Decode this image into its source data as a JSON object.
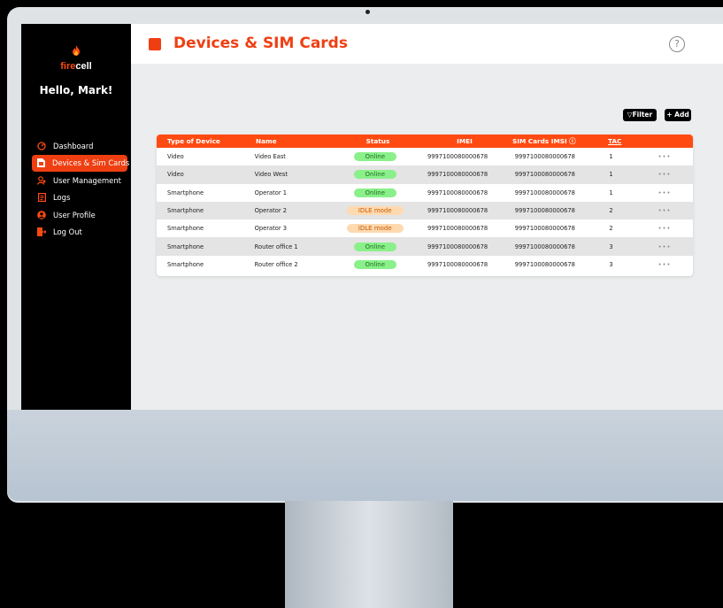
{
  "brand": {
    "fire": "fire",
    "cell": "cell"
  },
  "greeting": "Hello, Mark!",
  "nav": [
    {
      "label": "Dashboard",
      "icon": "dashboard-icon"
    },
    {
      "label": "Devices & Sim Cards",
      "icon": "sim-card-icon",
      "active": true
    },
    {
      "label": "User Management",
      "icon": "user-management-icon"
    },
    {
      "label": "Logs",
      "icon": "logs-icon"
    },
    {
      "label": "User Profile",
      "icon": "user-profile-icon"
    },
    {
      "label": "Log Out",
      "icon": "logout-icon"
    }
  ],
  "page": {
    "title": "Devices & SIM Cards",
    "help": "?"
  },
  "toolbar": {
    "filter": "Filter",
    "add": "+ Add"
  },
  "table": {
    "headers": [
      "Type of Device",
      "Name",
      "Status",
      "IMEI",
      "SIM Cards IMSI",
      "TAC"
    ],
    "rows": [
      {
        "type": "Video",
        "name": "Video East",
        "status": "Online",
        "imei": "9997100080000678",
        "imsi": "9997100080000678",
        "tac": "1",
        "more": "•••"
      },
      {
        "type": "Video",
        "name": "Video West",
        "status": "Online",
        "imei": "9997100080000678",
        "imsi": "9997100080000678",
        "tac": "1",
        "more": "•••"
      },
      {
        "type": "Smartphone",
        "name": "Operator 1",
        "status": "Online",
        "imei": "9997100080000678",
        "imsi": "9997100080000678",
        "tac": "1",
        "more": "•••"
      },
      {
        "type": "Smartphone",
        "name": "Operator 2",
        "status": "IDLE mode",
        "imei": "9997100080000678",
        "imsi": "9997100080000678",
        "tac": "2",
        "more": "•••"
      },
      {
        "type": "Smartphone",
        "name": "Operator 3",
        "status": "IDLE mode",
        "imei": "9997100080000678",
        "imsi": "9997100080000678",
        "tac": "2",
        "more": "•••"
      },
      {
        "type": "Smartphone",
        "name": "Router office 1",
        "status": "Online",
        "imei": "9997100080000678",
        "imsi": "9997100080000678",
        "tac": "3",
        "more": "•••"
      },
      {
        "type": "Smartphone",
        "name": "Router office 2",
        "status": "Online",
        "imei": "9997100080000678",
        "imsi": "9997100080000678",
        "tac": "3",
        "more": "•••"
      }
    ]
  },
  "colors": {
    "accent": "#ef3f12",
    "header": "#ff4a12",
    "online": "#8af08a",
    "idle": "#ffd9b0"
  }
}
